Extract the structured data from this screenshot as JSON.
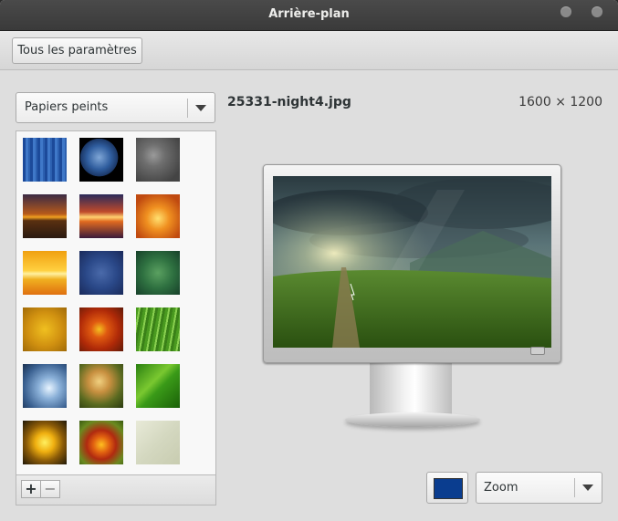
{
  "window": {
    "title": "Arrière-plan"
  },
  "toolbar": {
    "all_settings_label": "Tous les paramètres"
  },
  "source_combo": {
    "selected": "Papiers peints"
  },
  "gallery": {
    "thumbnails": [
      {
        "name": "blue-stripes-thumb"
      },
      {
        "name": "earth-thumb"
      },
      {
        "name": "water-drops-gray-thumb"
      },
      {
        "name": "sunset-dunes-thumb"
      },
      {
        "name": "orange-light-burst-thumb"
      },
      {
        "name": "orange-bokeh-thumb"
      },
      {
        "name": "yellow-glow-thumb"
      },
      {
        "name": "dark-blue-thumb"
      },
      {
        "name": "dark-green-thumb"
      },
      {
        "name": "yellow-radial-thumb"
      },
      {
        "name": "red-flower-thumb"
      },
      {
        "name": "green-grass-thumb"
      },
      {
        "name": "water-drop-blue-thumb"
      },
      {
        "name": "dandelion-thumb"
      },
      {
        "name": "green-leaf-thumb"
      },
      {
        "name": "yellow-flower-thumb"
      },
      {
        "name": "orange-flowers-thumb"
      },
      {
        "name": "pale-leaf-thumb"
      }
    ],
    "add_label": "+",
    "remove_label": "−"
  },
  "preview": {
    "filename": "25331-night4.jpg",
    "dimensions": "1600 × 1200"
  },
  "color": {
    "value": "#0a3d8f"
  },
  "placement": {
    "selected": "Zoom"
  }
}
